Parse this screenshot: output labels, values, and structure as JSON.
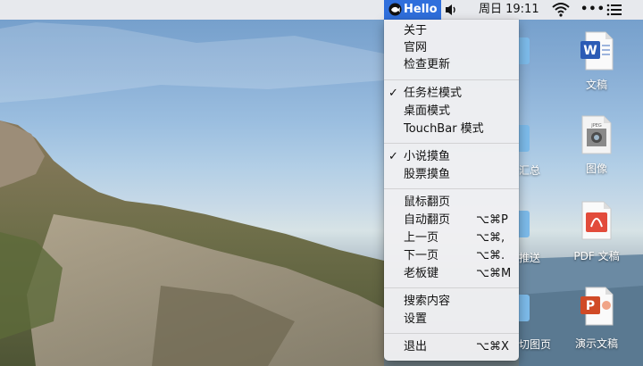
{
  "menubar": {
    "app_name": "Hello",
    "app_icon": "fish-logo-icon",
    "volume_icon": "speaker-icon",
    "clock": "周日 19:11",
    "wifi_icon": "wifi-icon",
    "more_icon": "•••",
    "list_icon": "list-icon",
    "active_color": "#2f6fdc"
  },
  "menu": {
    "items": [
      {
        "label": "关于",
        "checked": false,
        "shortcut": ""
      },
      {
        "label": "官网",
        "checked": false,
        "shortcut": ""
      },
      {
        "label": "检查更新",
        "checked": false,
        "shortcut": ""
      },
      {
        "label": "任务栏模式",
        "checked": true,
        "shortcut": ""
      },
      {
        "label": "桌面模式",
        "checked": false,
        "shortcut": ""
      },
      {
        "label": "TouchBar 模式",
        "checked": false,
        "shortcut": ""
      },
      {
        "label": "小说摸鱼",
        "checked": true,
        "shortcut": ""
      },
      {
        "label": "股票摸鱼",
        "checked": false,
        "shortcut": ""
      },
      {
        "label": "鼠标翻页",
        "checked": false,
        "shortcut": ""
      },
      {
        "label": "自动翻页",
        "checked": false,
        "shortcut": "⌥⌘P"
      },
      {
        "label": "上一页",
        "checked": false,
        "shortcut": "⌥⌘,"
      },
      {
        "label": "下一页",
        "checked": false,
        "shortcut": "⌥⌘."
      },
      {
        "label": "老板键",
        "checked": false,
        "shortcut": "⌥⌘M"
      },
      {
        "label": "搜索内容",
        "checked": false,
        "shortcut": ""
      },
      {
        "label": "设置",
        "checked": false,
        "shortcut": ""
      },
      {
        "label": "退出",
        "checked": false,
        "shortcut": "⌥⌘X"
      }
    ],
    "check_mark": "✓"
  },
  "desktop": {
    "icons": [
      {
        "name": "word-doc-icon",
        "caption": "文稿"
      },
      {
        "name": "image-file-icon",
        "caption": "图像"
      },
      {
        "name": "pdf-file-icon",
        "caption": "PDF 文稿"
      },
      {
        "name": "powerpoint-file-icon",
        "caption": "演示文稿"
      }
    ],
    "partial_labels": [
      "汇总",
      "推送",
      "切图页"
    ]
  }
}
